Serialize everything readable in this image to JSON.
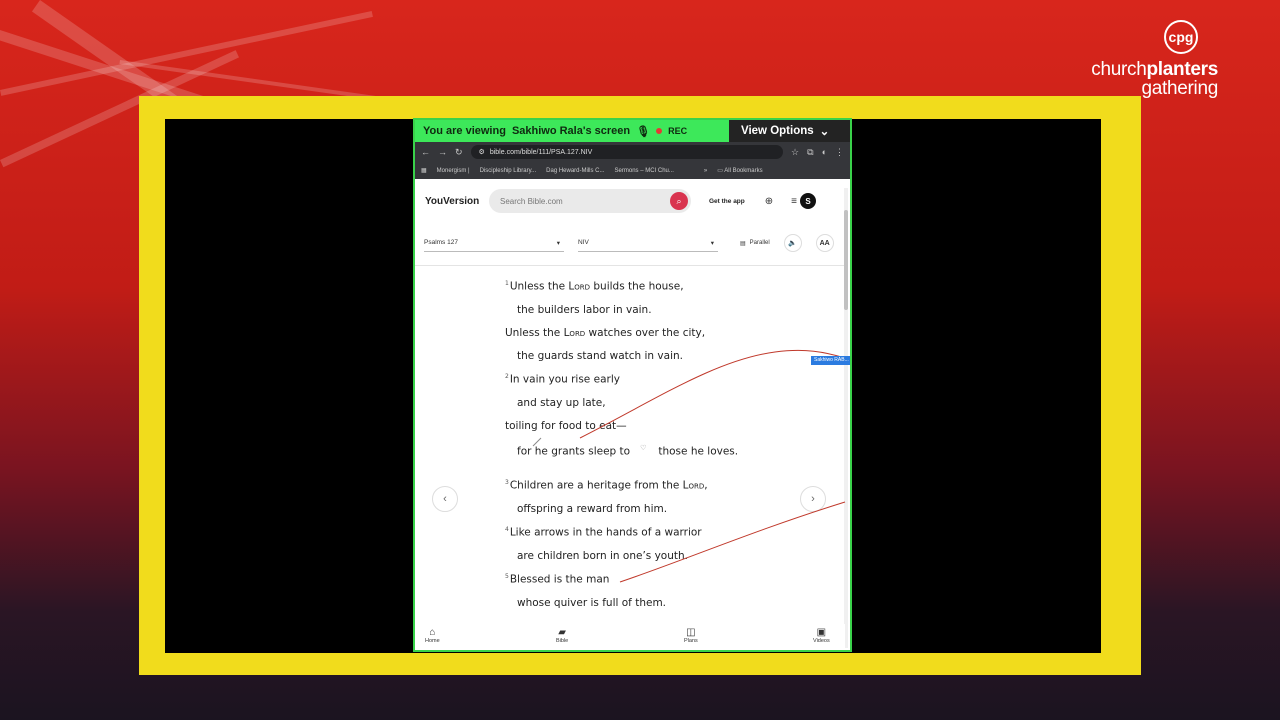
{
  "brand": {
    "circle": "cpg",
    "line1_regular": "church",
    "line1_bold": "planters",
    "line2": "gathering"
  },
  "share": {
    "viewing_prefix": "You are viewing",
    "viewing_name": "Sakhiwo Rala's screen",
    "rec": "REC",
    "view_options": "View Options"
  },
  "browser": {
    "url": "bible.com/bible/111/PSA.127.NIV",
    "bookmarks": [
      "Monergism |",
      "Discipleship Library...",
      "Dag Heward-Mills C...",
      "Sermons – MCI Chu..."
    ],
    "all_bookmarks": "All Bookmarks"
  },
  "youversion": {
    "logo": "YouVersion",
    "search_placeholder": "Search Bible.com",
    "get_app": "Get the app",
    "avatar": "S",
    "book_select": "Psalms 127",
    "version_select": "NIV",
    "parallel": "Parallel",
    "font_button": "AA"
  },
  "verses": {
    "v1_num": "1",
    "l1_a": "Unless the ",
    "l1_lord": "Lord",
    "l1_b": " builds the house,",
    "l2": "the builders labor in vain.",
    "l3_a": "Unless the ",
    "l3_lord": "Lord",
    "l3_b": " watches over the city,",
    "l4": "the guards stand watch in vain.",
    "v2_num": "2",
    "l5": "In vain you rise early",
    "l6": "and stay up late,",
    "l7": "toiling for food to eat—",
    "l8_a": "for he grants sleep to",
    "l8_b": "those he loves.",
    "v3_num": "3",
    "l9_a": "Children are a heritage from the ",
    "l9_lord": "Lord",
    "l9_b": ",",
    "l10": "offspring a reward from him.",
    "v4_num": "4",
    "l11": "Like arrows in the hands of a warrior",
    "l12": "are children born in one’s youth.",
    "v5_num": "5",
    "l13": "Blessed is the man",
    "l14": "whose quiver is full of them."
  },
  "bottom_nav": {
    "home": "Home",
    "bible": "Bible",
    "plans": "Plans",
    "videos": "Videos"
  },
  "cursor_tag": "Sakhiwo RAB..."
}
